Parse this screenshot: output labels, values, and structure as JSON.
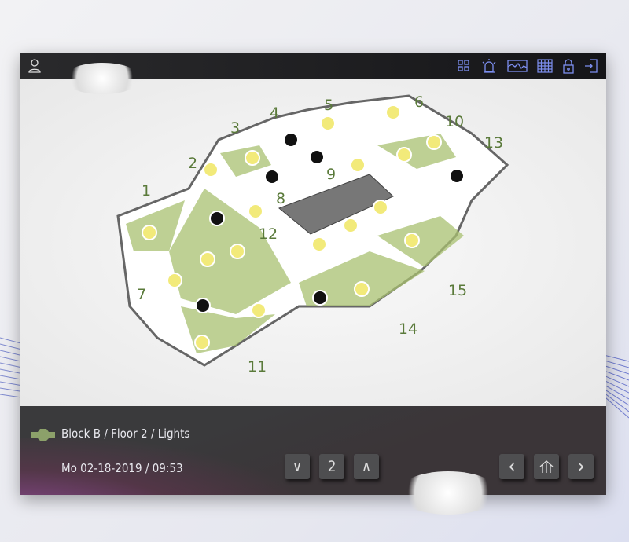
{
  "topbar": {
    "icons": [
      "user-icon",
      "grid-icon",
      "alarm-icon",
      "chart-icon",
      "table-icon",
      "lock-icon",
      "logout-icon"
    ]
  },
  "floorplan": {
    "rooms": [
      "1",
      "2",
      "3",
      "4",
      "5",
      "6",
      "7",
      "8",
      "9",
      "10",
      "11",
      "12",
      "13",
      "14",
      "15"
    ],
    "lights": [
      "on",
      "on",
      "on",
      "on",
      "on",
      "on",
      "on",
      "on",
      "on",
      "on",
      "on",
      "on",
      "on",
      "on",
      "on",
      "on",
      "on",
      "on",
      "on",
      "off",
      "off",
      "off",
      "off",
      "off",
      "off",
      "off"
    ],
    "colors": {
      "on": "#f2ea7a",
      "off": "#111111",
      "label": "#5a7a3a",
      "floor": "#a8c070"
    }
  },
  "footer": {
    "breadcrumb": "Block B / Floor 2 / Lights",
    "datetime": "Mo 02-18-2019 / 09:53",
    "floor_down": "∨",
    "floor_value": "2",
    "floor_up": "∧",
    "prev": "‹",
    "next": "›",
    "home_icon": "home-icon"
  }
}
